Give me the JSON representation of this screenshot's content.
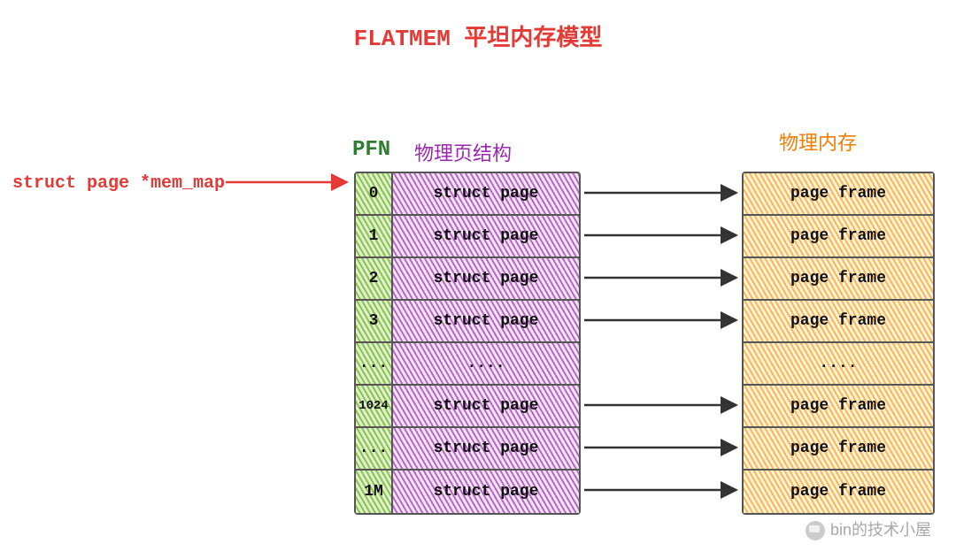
{
  "title": "FLATMEM 平坦内存模型",
  "pointer_label": "struct page *mem_map",
  "headers": {
    "pfn": "PFN",
    "struct": "物理页结构",
    "mem": "物理内存"
  },
  "rows": [
    {
      "pfn": "0",
      "struct": "struct page",
      "frame": "page frame",
      "arrow": true
    },
    {
      "pfn": "1",
      "struct": "struct page",
      "frame": "page frame",
      "arrow": true
    },
    {
      "pfn": "2",
      "struct": "struct page",
      "frame": "page frame",
      "arrow": true
    },
    {
      "pfn": "3",
      "struct": "struct page",
      "frame": "page frame",
      "arrow": true
    },
    {
      "pfn": "...",
      "struct": "....",
      "frame": "....",
      "arrow": false
    },
    {
      "pfn": "1024",
      "struct": "struct page",
      "frame": "page frame",
      "arrow": true
    },
    {
      "pfn": "...",
      "struct": "struct page",
      "frame": "page frame",
      "arrow": true
    },
    {
      "pfn": "1M",
      "struct": "struct page",
      "frame": "page frame",
      "arrow": true
    }
  ],
  "watermark": "bin的技术小屋",
  "colors": {
    "title": "#e53935",
    "pfn_header": "#2e7d32",
    "struct_header": "#9c27b0",
    "mem_header": "#f57c00",
    "pfn_fill": "#8bc34a",
    "struct_fill": "#ba68c8",
    "frame_fill": "#ffb74d"
  }
}
